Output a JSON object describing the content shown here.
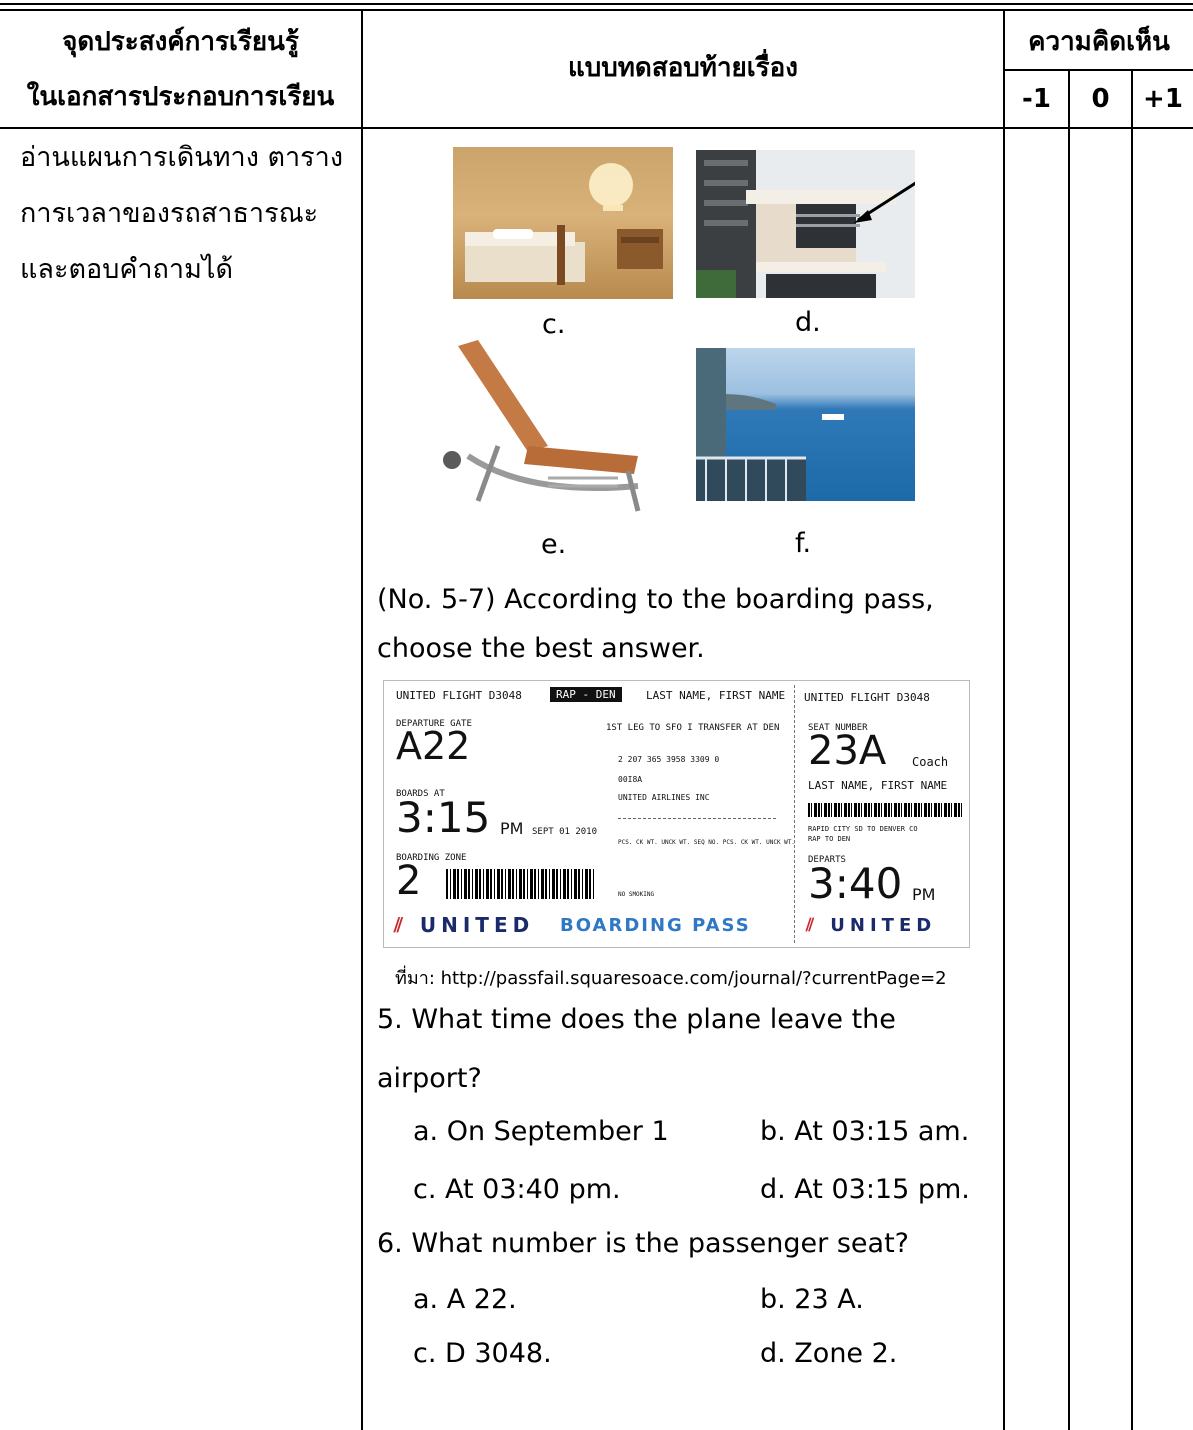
{
  "header": {
    "col1_line1": "จุดประสงค์การเรียนรู้",
    "col1_line2": "ในเอกสารประกอบการเรียน",
    "col2": "แบบทดสอบท้ายเรื่อง",
    "col3": "ความคิดเห็น",
    "ratings": [
      "-1",
      "0",
      "+1"
    ]
  },
  "objective": {
    "lines": [
      "อ่านแผนการเดินทาง ตาราง",
      "การเวลาของรถสาธารณะ",
      "และตอบคำถามได้"
    ]
  },
  "pictures": {
    "c": "c.",
    "d": "d.",
    "e": "e.",
    "f": "f."
  },
  "intro": {
    "line1": "(No. 5-7)  According to the boarding pass,",
    "line2": "choose the best answer."
  },
  "boarding_pass": {
    "flight_left": "UNITED FLIGHT D3048",
    "route": "RAP - DEN",
    "name_header": "LAST NAME, FIRST NAME",
    "flight_right": "UNITED FLIGHT D3048",
    "departure_gate_label": "DEPARTURE GATE",
    "gate": "A22",
    "leg_info": "1ST LEG TO SFO I TRANSFER AT DEN",
    "ticket_number": "2 207 365 3958 3309 0",
    "code": "00I8A",
    "airline": "UNITED AIRLINES INC",
    "pcs_line": "PCS. CK WT. UNCK WT. SEQ NO. PCS. CK WT. UNCK WT.",
    "no_smoking": "NO SMOKING",
    "boards_at_label": "BOARDS AT",
    "boards_time": "3:15",
    "boards_pm": "PM",
    "date": "SEPT 01 2010",
    "boarding_zone_label": "BOARDING ZONE",
    "zone": "2",
    "brand_united": "UNITED",
    "brand_boarding_pass": "BOARDING PASS",
    "seat_label": "SEAT NUMBER",
    "seat": "23A",
    "coach": "Coach",
    "name_right": "LAST NAME, FIRST NAME",
    "cities": "RAPID CITY SD TO DENVER CO",
    "cities_code": "RAP TO DEN",
    "departs_label": "DEPARTS",
    "departs_time": "3:40",
    "departs_pm": "PM",
    "brand_united_right": "UNITED"
  },
  "source": "ที่มา:  http://passfail.squaresoace.com/journal/?currentPage=2",
  "q5": {
    "line1": "5.  What time does the plane leave the",
    "line2": "airport?",
    "a": "a.  On September 1",
    "b": "b.  At 03:15 am.",
    "c": "c.  At 03:40 pm.",
    "d": "d.  At 03:15 pm."
  },
  "q6": {
    "question": "6.  What number is the passenger seat?",
    "a": "a.  A 22.",
    "b": "b.  23 A.",
    "c": "c.  D 3048.",
    "d": "d.  Zone 2."
  }
}
